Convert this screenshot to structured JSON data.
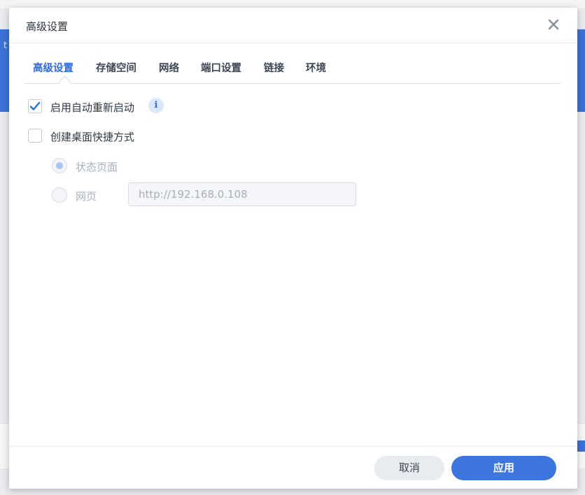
{
  "background": {
    "fragment_letter": "t"
  },
  "dialog": {
    "title": "高级设置",
    "close_icon": "close-x-icon"
  },
  "tabs": [
    {
      "label": "高级设置",
      "active": true
    },
    {
      "label": "存储空间",
      "active": false
    },
    {
      "label": "网络",
      "active": false
    },
    {
      "label": "端口设置",
      "active": false
    },
    {
      "label": "链接",
      "active": false
    },
    {
      "label": "环境",
      "active": false
    }
  ],
  "options": {
    "auto_restart": {
      "label": "启用自动重新启动",
      "checked": true,
      "info_icon": "i"
    },
    "desktop_shortcut": {
      "label": "创建桌面快捷方式",
      "checked": false
    },
    "shortcut_targets": [
      {
        "label": "状态页面",
        "selected": true,
        "disabled": true
      },
      {
        "label": "网页",
        "selected": false,
        "disabled": true
      }
    ],
    "web_url": {
      "value": "http://192.168.0.108",
      "disabled": true
    }
  },
  "footer": {
    "cancel_label": "取消",
    "apply_label": "应用"
  },
  "colors": {
    "accent": "#3d76de",
    "active_tab": "#2f6ddb",
    "background_blue": "#3c72d6"
  }
}
